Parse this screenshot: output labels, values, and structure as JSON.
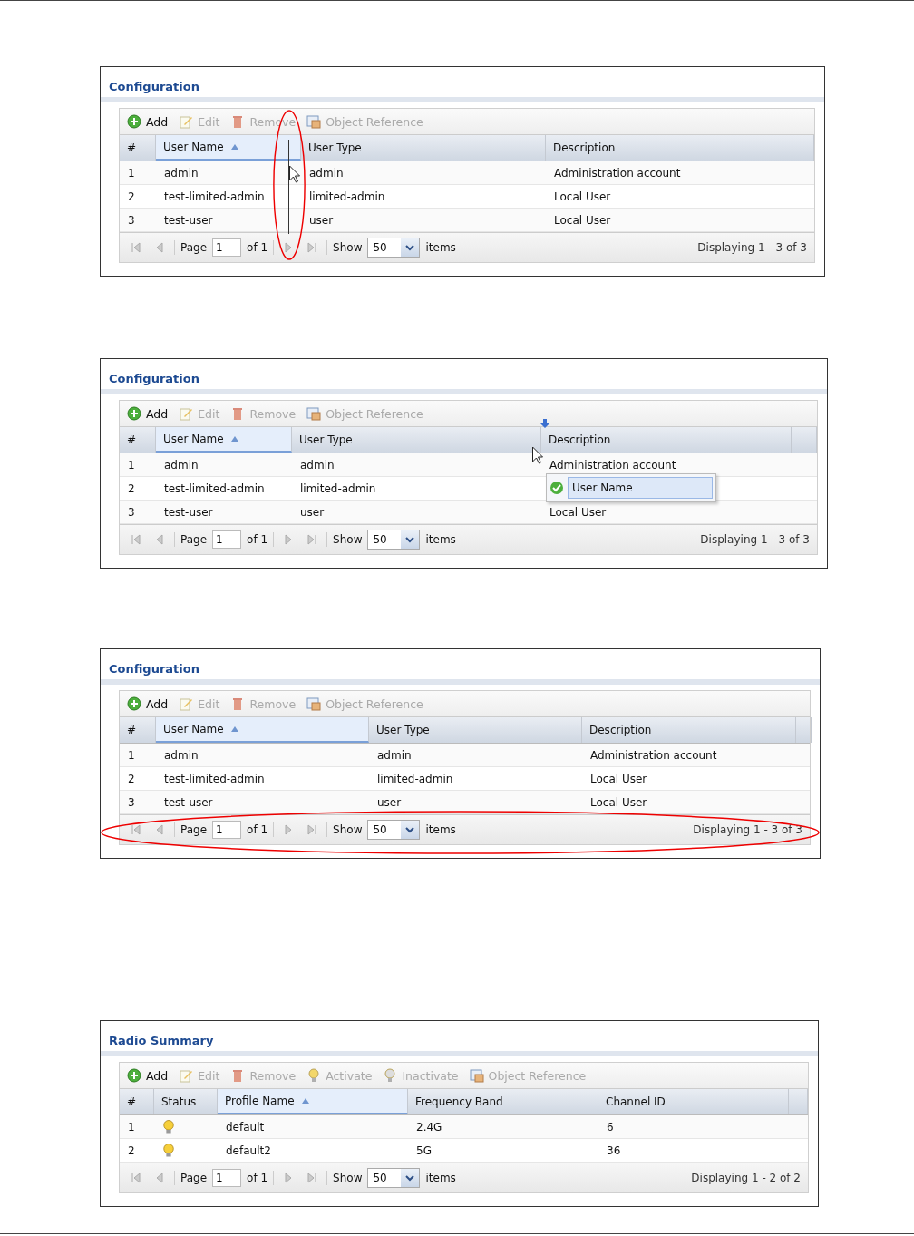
{
  "panels": [
    {
      "title": "Configuration",
      "divider_highlighted": true,
      "resize_cursor": true,
      "toolbar": [
        {
          "label": "Add",
          "kind": "add",
          "disabled": false
        },
        {
          "label": "Edit",
          "kind": "edit",
          "disabled": true
        },
        {
          "label": "Remove",
          "kind": "remove",
          "disabled": true
        },
        {
          "label": "Object Reference",
          "kind": "reference",
          "disabled": true
        }
      ],
      "columns": [
        {
          "label": "#",
          "sorted": false
        },
        {
          "label": "User Name",
          "sorted": true
        },
        {
          "label": "User Type",
          "sorted": false
        },
        {
          "label": "Description",
          "sorted": false
        }
      ],
      "rows": [
        {
          "cells": [
            "1",
            "admin",
            "admin",
            "Administration account"
          ]
        },
        {
          "cells": [
            "2",
            "test-limited-admin",
            "limited-admin",
            "Local User"
          ]
        },
        {
          "cells": [
            "3",
            "test-user",
            "user",
            "Local User"
          ]
        }
      ],
      "pager": {
        "page_label": "Page",
        "page": "1",
        "of": "of 1",
        "show_label": "Show",
        "show": "50",
        "items_label": "items",
        "displaying": "Displaying 1 - 3 of 3"
      }
    },
    {
      "title": "Configuration",
      "drop_cursor": true,
      "popup": {
        "label": "User Name"
      },
      "toolbar": [
        {
          "label": "Add",
          "kind": "add",
          "disabled": false
        },
        {
          "label": "Edit",
          "kind": "edit",
          "disabled": true
        },
        {
          "label": "Remove",
          "kind": "remove",
          "disabled": true
        },
        {
          "label": "Object Reference",
          "kind": "reference",
          "disabled": true
        }
      ],
      "columns": [
        {
          "label": "#",
          "sorted": false
        },
        {
          "label": "User Name",
          "sorted": true
        },
        {
          "label": "User Type",
          "sorted": false
        },
        {
          "label": "Description",
          "sorted": false
        }
      ],
      "rows": [
        {
          "cells": [
            "1",
            "admin",
            "admin",
            "Administration account"
          ]
        },
        {
          "cells": [
            "2",
            "test-limited-admin",
            "limited-admin"
          ]
        },
        {
          "cells": [
            "3",
            "test-user",
            "user",
            "Local User"
          ]
        }
      ],
      "pager": {
        "page_label": "Page",
        "page": "1",
        "of": "of 1",
        "show_label": "Show",
        "show": "50",
        "items_label": "items",
        "displaying": "Displaying 1 - 3 of 3"
      }
    },
    {
      "title": "Configuration",
      "pager_highlighted": true,
      "toolbar": [
        {
          "label": "Add",
          "kind": "add",
          "disabled": false
        },
        {
          "label": "Edit",
          "kind": "edit",
          "disabled": true
        },
        {
          "label": "Remove",
          "kind": "remove",
          "disabled": true
        },
        {
          "label": "Object Reference",
          "kind": "reference",
          "disabled": true
        }
      ],
      "columns": [
        {
          "label": "#",
          "sorted": false
        },
        {
          "label": "User Name",
          "sorted": true
        },
        {
          "label": "User Type",
          "sorted": false
        },
        {
          "label": "Description",
          "sorted": false
        }
      ],
      "rows": [
        {
          "cells": [
            "1",
            "admin",
            "admin",
            "Administration account"
          ]
        },
        {
          "cells": [
            "2",
            "test-limited-admin",
            "limited-admin",
            "Local User"
          ]
        },
        {
          "cells": [
            "3",
            "test-user",
            "user",
            "Local User"
          ]
        }
      ],
      "pager": {
        "page_label": "Page",
        "page": "1",
        "of": "of 1",
        "show_label": "Show",
        "show": "50",
        "items_label": "items",
        "displaying": "Displaying 1 - 3 of 3"
      }
    },
    {
      "title": "Radio Summary",
      "toolbar": [
        {
          "label": "Add",
          "kind": "add",
          "disabled": false
        },
        {
          "label": "Edit",
          "kind": "edit",
          "disabled": true
        },
        {
          "label": "Remove",
          "kind": "remove",
          "disabled": true
        },
        {
          "label": "Activate",
          "kind": "activate",
          "disabled": true
        },
        {
          "label": "Inactivate",
          "kind": "inactivate",
          "disabled": true
        },
        {
          "label": "Object Reference",
          "kind": "reference",
          "disabled": true
        }
      ],
      "columns": [
        {
          "label": "#",
          "sorted": false
        },
        {
          "label": "Status",
          "sorted": false
        },
        {
          "label": "Profile Name",
          "sorted": true
        },
        {
          "label": "Frequency Band",
          "sorted": false
        },
        {
          "label": "Channel ID",
          "sorted": false
        }
      ],
      "rows": [
        {
          "cells": [
            "1",
            {
              "active": true
            },
            "default",
            "2.4G",
            "6"
          ]
        },
        {
          "cells": [
            "2",
            {
              "active": true
            },
            "default2",
            "5G",
            "36"
          ]
        }
      ],
      "pager": {
        "page_label": "Page",
        "page": "1",
        "of": "of 1",
        "show_label": "Show",
        "show": "50",
        "items_label": "items",
        "displaying": "Displaying 1 - 2 of 2"
      }
    }
  ]
}
